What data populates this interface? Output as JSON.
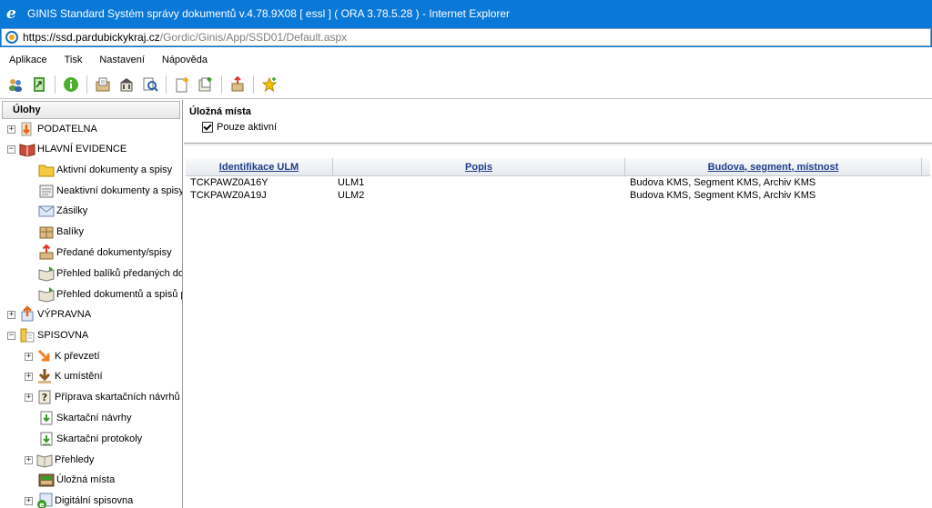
{
  "window": {
    "title": "GINIS Standard Systém správy dokumentů v.4.78.9X08 [ essl ] ( ORA 3.78.5.28 ) - Internet Explorer",
    "url_host": "https://ssd.pardubickykraj.cz",
    "url_path": "/Gordic/Ginis/App/SSD01/Default.aspx"
  },
  "menu": [
    "Aplikace",
    "Tisk",
    "Nastavení",
    "Nápověda"
  ],
  "tree": {
    "header": "Úlohy",
    "items": [
      {
        "label": "PODATELNA",
        "toggle": "+",
        "icon": "inbox-icon"
      },
      {
        "label": "HLAVNÍ EVIDENCE",
        "toggle": "−",
        "icon": "book-icon"
      },
      {
        "label": "Aktivní dokumenty a spisy",
        "icon": "folder-icon"
      },
      {
        "label": "Neaktivní dokumenty a spisy",
        "icon": "document-icon"
      },
      {
        "label": "Zásilky",
        "icon": "envelope-icon"
      },
      {
        "label": "Balíky",
        "icon": "package-icon"
      },
      {
        "label": "Předané dokumenty/spisy",
        "icon": "handover-icon"
      },
      {
        "label": "Přehled balíků předaných do sp",
        "icon": "book-arrow-icon"
      },
      {
        "label": "Přehled dokumentů a spisů před",
        "icon": "book-arrow-icon"
      },
      {
        "label": "VÝPRAVNA",
        "toggle": "+",
        "icon": "outbox-icon"
      },
      {
        "label": "SPISOVNA",
        "toggle": "−",
        "icon": "archive-icon"
      },
      {
        "label": "K převzetí",
        "toggle": "+",
        "icon": "arrow-receive-icon"
      },
      {
        "label": "K umístění",
        "toggle": "+",
        "icon": "arrow-place-icon"
      },
      {
        "label": "Příprava skartačních návrhů",
        "toggle": "+",
        "icon": "question-doc-icon"
      },
      {
        "label": "Skartační návrhy",
        "icon": "shred-proposal-icon"
      },
      {
        "label": "Skartační protokoly",
        "icon": "shred-protocol-icon"
      },
      {
        "label": "Přehledy",
        "toggle": "+",
        "icon": "book-icon"
      },
      {
        "label": "Úložná místa",
        "icon": "storage-icon"
      },
      {
        "label": "Digitální spisovna",
        "toggle": "+",
        "icon": "digital-archive-icon"
      }
    ]
  },
  "content": {
    "title": "Úložná místa",
    "checkbox_label": "Pouze aktivní",
    "columns": [
      "Identifikace ULM",
      "Popis",
      "Budova, segment, místnost"
    ],
    "rows": [
      [
        "TCKPAWZ0A16Y",
        "ULM1",
        "Budova KMS, Segment KMS, Archiv KMS"
      ],
      [
        "TCKPAWZ0A19J",
        "ULM2",
        "Budova KMS, Segment KMS, Archiv KMS"
      ]
    ]
  }
}
